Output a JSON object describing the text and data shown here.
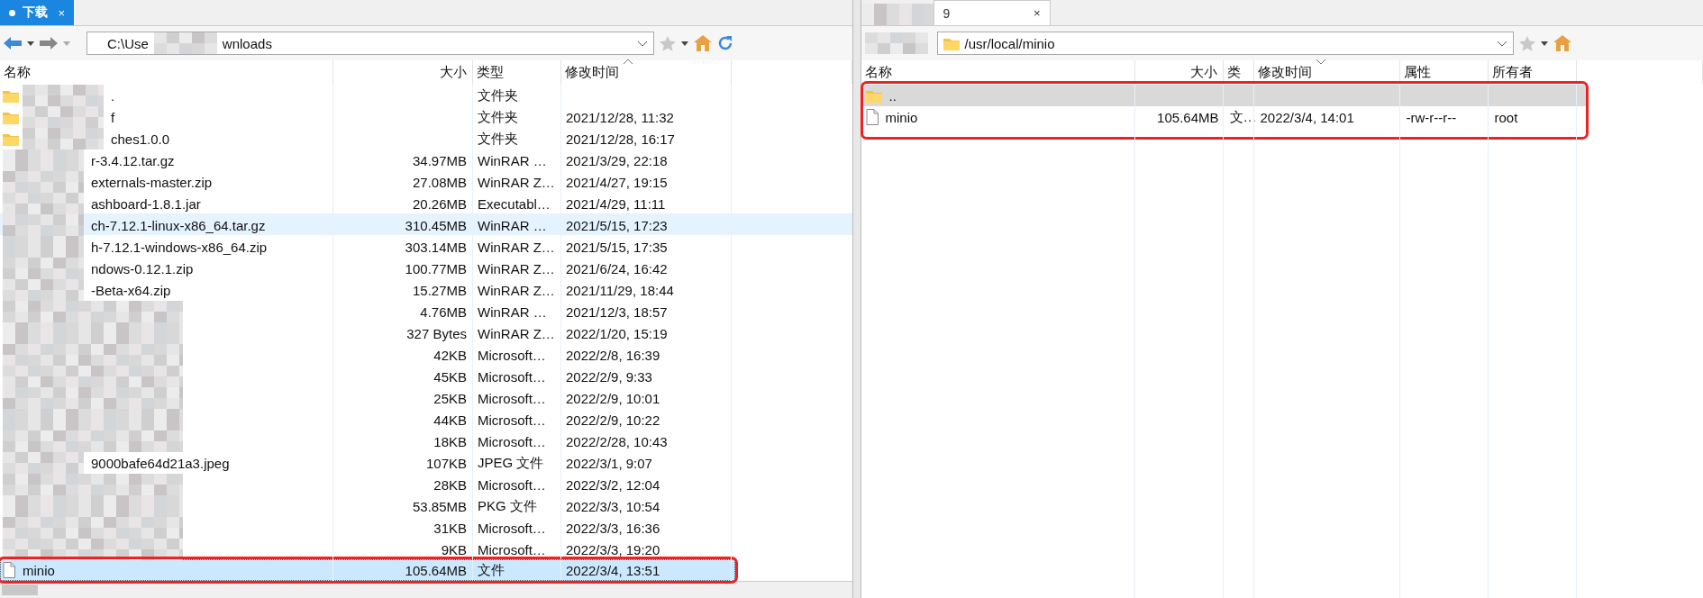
{
  "panes": [
    {
      "tab": {
        "label": "下载",
        "close": "×",
        "selected": true
      },
      "path": "C:\\Use",
      "path_end": "wnloads",
      "columns": [
        "名称",
        "大小",
        "类型",
        "修改时间"
      ],
      "rows": [
        {
          "kind": "folder",
          "blurred": true,
          "name": ".",
          "type": "文件夹",
          "selected": false,
          "hover": false,
          "framed": false
        },
        {
          "kind": "folder",
          "blurred": true,
          "name": "f",
          "type": "文件夹",
          "date": "2021/12/28, 11:32",
          "selected": false,
          "hover": false,
          "framed": false
        },
        {
          "kind": "folder",
          "blurred": true,
          "name": "ches1.0.0",
          "type": "文件夹",
          "date": "2021/12/28, 16:17",
          "selected": false,
          "hover": false,
          "framed": false
        },
        {
          "kind": "other",
          "blurred": true,
          "name": "r-3.4.12.tar.gz",
          "size": "34.97MB",
          "type": "WinRAR …",
          "date": "2021/3/29, 22:18",
          "selected": false,
          "hover": false,
          "framed": false
        },
        {
          "kind": "other",
          "blurred": true,
          "name": "externals-master.zip",
          "size": "27.08MB",
          "type": "WinRAR Z…",
          "date": "2021/4/27, 19:15",
          "selected": false,
          "hover": false,
          "framed": false
        },
        {
          "kind": "other",
          "blurred": true,
          "name": "ashboard-1.8.1.jar",
          "size": "20.26MB",
          "type": "Executabl…",
          "date": "2021/4/29, 11:11",
          "selected": false,
          "hover": false,
          "framed": false
        },
        {
          "kind": "other",
          "blurred": true,
          "name": "ch-7.12.1-linux-x86_64.tar.gz",
          "size": "310.45MB",
          "type": "WinRAR …",
          "date": "2021/5/15, 17:23",
          "selected": false,
          "hover": true,
          "framed": false
        },
        {
          "kind": "other",
          "blurred": true,
          "name": "h-7.12.1-windows-x86_64.zip",
          "size": "303.14MB",
          "type": "WinRAR Z…",
          "date": "2021/5/15, 17:35",
          "selected": false,
          "hover": false,
          "framed": false
        },
        {
          "kind": "other",
          "blurred": true,
          "name": "ndows-0.12.1.zip",
          "size": "100.77MB",
          "type": "WinRAR Z…",
          "date": "2021/6/24, 16:42",
          "selected": false,
          "hover": false,
          "framed": false
        },
        {
          "kind": "other",
          "blurred": true,
          "name": "-Beta-x64.zip",
          "size": "15.27MB",
          "type": "WinRAR Z…",
          "date": "2021/11/29, 18:44",
          "selected": false,
          "hover": false,
          "framed": false
        },
        {
          "kind": "other",
          "blurred": true,
          "size": "4.76MB",
          "type": "WinRAR …",
          "date": "2021/12/3, 18:57",
          "selected": false,
          "hover": false,
          "framed": false
        },
        {
          "kind": "other",
          "blurred": true,
          "size": "327 Bytes",
          "type": "WinRAR Z…",
          "date": "2022/1/20, 15:19",
          "selected": false,
          "hover": false,
          "framed": false
        },
        {
          "kind": "other",
          "blurred": true,
          "size": "42KB",
          "type": "Microsoft…",
          "date": "2022/2/8, 16:39",
          "selected": false,
          "hover": false,
          "framed": false
        },
        {
          "kind": "other",
          "blurred": true,
          "size": "45KB",
          "type": "Microsoft…",
          "date": "2022/2/9, 9:33",
          "selected": false,
          "hover": false,
          "framed": false
        },
        {
          "kind": "other",
          "blurred": true,
          "size": "25KB",
          "type": "Microsoft…",
          "date": "2022/2/9, 10:01",
          "selected": false,
          "hover": false,
          "framed": false
        },
        {
          "kind": "other",
          "blurred": true,
          "size": "44KB",
          "type": "Microsoft…",
          "date": "2022/2/9, 10:22",
          "selected": false,
          "hover": false,
          "framed": false
        },
        {
          "kind": "other",
          "blurred": true,
          "size": "18KB",
          "type": "Microsoft…",
          "date": "2022/2/28, 10:43",
          "selected": false,
          "hover": false,
          "framed": false
        },
        {
          "kind": "other",
          "blurred": true,
          "name": "9000bafe64d21a3.jpeg",
          "size": "107KB",
          "type": "JPEG 文件",
          "date": "2022/3/1, 9:07",
          "selected": false,
          "hover": false,
          "framed": false
        },
        {
          "kind": "other",
          "blurred": true,
          "size": "28KB",
          "type": "Microsoft…",
          "date": "2022/3/2, 12:04",
          "selected": false,
          "hover": false,
          "framed": false
        },
        {
          "kind": "other",
          "blurred": true,
          "size": "53.85MB",
          "type": "PKG 文件",
          "date": "2022/3/3, 10:54",
          "selected": false,
          "hover": false,
          "framed": false
        },
        {
          "kind": "other",
          "blurred": true,
          "size": "31KB",
          "type": "Microsoft…",
          "date": "2022/3/3, 16:36",
          "selected": false,
          "hover": false,
          "framed": false
        },
        {
          "kind": "other",
          "blurred": true,
          "size": "9KB",
          "type": "Microsoft…",
          "date": "2022/3/3, 19:20",
          "selected": false,
          "hover": false,
          "framed": false
        },
        {
          "kind": "file",
          "blurred": false,
          "name": "minio",
          "size": "105.64MB",
          "type": "文件",
          "date": "2022/3/4, 13:51",
          "selected": true,
          "hover": false,
          "framed": true
        }
      ]
    },
    {
      "tab": {
        "label": "9",
        "close": "×",
        "selected": false
      },
      "path": "/usr/local/minio",
      "columns": [
        "名称",
        "大小",
        "类",
        "修改时间",
        "属性",
        "所有者"
      ],
      "rows": [
        {
          "kind": "folder",
          "blurred": false,
          "name": "..",
          "selected": true,
          "hover": false,
          "framed": true
        },
        {
          "kind": "file",
          "blurred": false,
          "name": "minio",
          "size": "105.64MB",
          "type": "文…",
          "date": "2022/3/4, 14:01",
          "perms": "-rw-r--r--",
          "owner": "root",
          "selected": false,
          "hover": false,
          "framed": true
        }
      ]
    }
  ]
}
